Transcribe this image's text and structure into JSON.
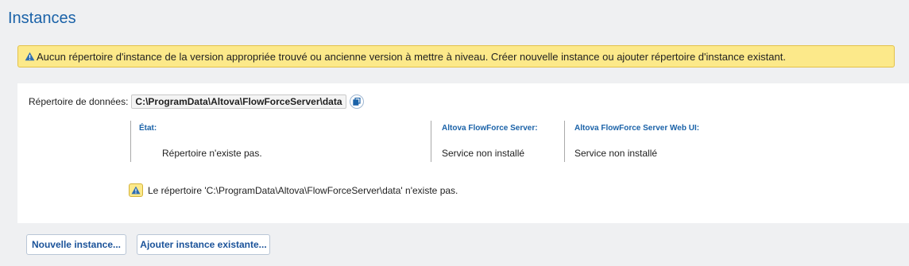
{
  "page": {
    "title": "Instances"
  },
  "banner": {
    "icon": "warning-icon",
    "text": "Aucun répertoire d'instance de la version appropriée trouvé ou ancienne version à mettre à niveau. Créer nouvelle instance ou ajouter répertoire d'instance existant."
  },
  "data_dir": {
    "label": "Répertoire de données:",
    "value": "C:\\ProgramData\\Altova\\FlowForceServer\\data",
    "copy_icon": "copy-icon"
  },
  "status": {
    "state_header": "État:",
    "state_value": "Répertoire n'existe pas.",
    "server_header": "Altova FlowForce Server:",
    "server_value": "Service non installé",
    "webui_header": "Altova FlowForce Server Web UI:",
    "webui_value": "Service non installé"
  },
  "error": {
    "icon": "warning-icon",
    "text": "Le répertoire 'C:\\ProgramData\\Altova\\FlowForceServer\\data' n'existe pas."
  },
  "actions": {
    "new_instance": "Nouvelle instance...",
    "add_existing": "Ajouter instance existante..."
  },
  "colors": {
    "accent": "#1a62a8",
    "warning_bg": "#fce98a"
  }
}
